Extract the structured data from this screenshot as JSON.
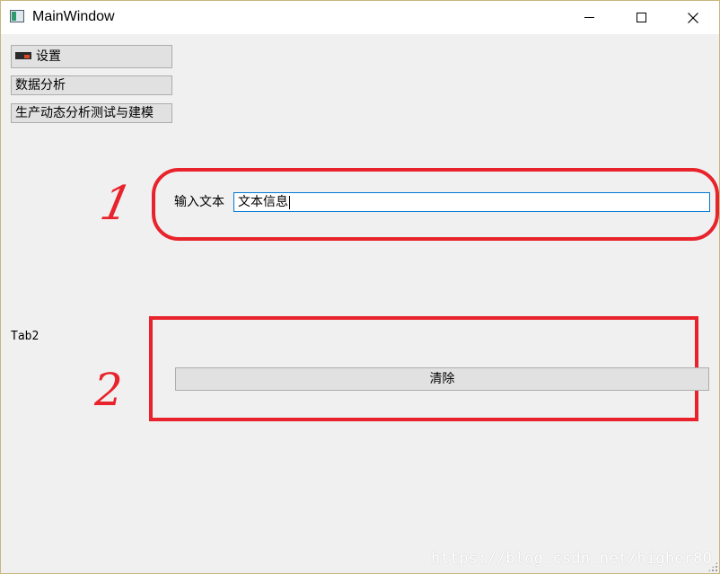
{
  "window": {
    "title": "MainWindow",
    "border_color": "#c9b77e"
  },
  "sidebar": {
    "buttons": [
      {
        "label": "设置",
        "icon": "signal-bars-icon"
      },
      {
        "label": "数据分析"
      },
      {
        "label": "生产动态分析测试与建模"
      }
    ]
  },
  "main": {
    "input_label": "输入文本",
    "input_value": "文本信息",
    "tab_label": "Tab2",
    "clear_button": "清除"
  },
  "annotations": {
    "color": "#e8232b",
    "marks": [
      {
        "label": "1"
      },
      {
        "label": "2"
      }
    ]
  },
  "watermark": "https://blog.csdn.net/higher80"
}
